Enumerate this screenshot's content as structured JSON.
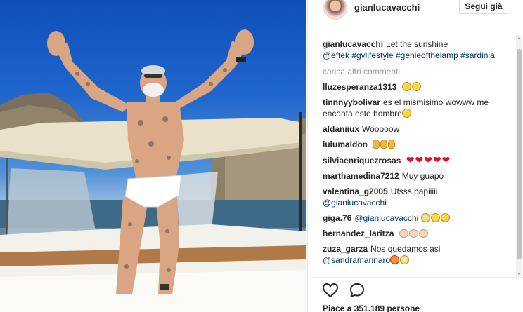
{
  "post": {
    "username": "gianlucavacchi",
    "follow_label": "Segui già",
    "caption_user": "gianlucavacchi",
    "caption_text": "Let the sunshine",
    "caption_tags": "@effek #gvlifestyle #genieofthelamp #sardinia",
    "load_more": "carica altri commenti",
    "likes": "Piace a 351.189 persone"
  },
  "comments": [
    {
      "user": "lluzesperanza1313",
      "text": "",
      "tag": "",
      "icons": [
        "smile-emoji",
        "smile-emoji"
      ]
    },
    {
      "user": "tinnnyybolivar",
      "text": "es el mismisimo wowww me encanta este hombre",
      "tag": "",
      "icons": [
        "smile-emoji"
      ]
    },
    {
      "user": "aldaniiux",
      "text": "Wooooow",
      "tag": "",
      "icons": []
    },
    {
      "user": "lulumaldon",
      "text": "",
      "tag": "",
      "icons": [
        "ok-hand-emoji",
        "ok-hand-emoji",
        "ok-hand-emoji"
      ]
    },
    {
      "user": "silviaenriquezrosas",
      "text": "",
      "tag": "",
      "icons": [
        "heart-emoji",
        "heart-emoji",
        "heart-emoji",
        "heart-emoji",
        "heart-emoji"
      ]
    },
    {
      "user": "marthamedina7212",
      "text": "Muy guapo",
      "tag": "",
      "icons": []
    },
    {
      "user": "valentina_g2005",
      "text": "Ufsss papiiiii",
      "tag": "@gianlucavacchi",
      "icons": []
    },
    {
      "user": "giga.76",
      "text": "",
      "tag": "@gianlucavacchi",
      "icons": [
        "scream-emoji",
        "smile-emoji",
        "kiss-emoji"
      ]
    },
    {
      "user": "hernandez_laritza",
      "text": "",
      "tag": "",
      "icons": [
        "clap-emoji",
        "clap-emoji",
        "clap-emoji"
      ]
    },
    {
      "user": "zuza_garza",
      "text": "Nos quedamos asi",
      "tag": "@sandramarinaro",
      "icons": [
        "angry-emoji",
        "scream-emoji"
      ]
    }
  ],
  "colors": {
    "link": "#003569",
    "heart": "#e0102e",
    "sky": "#1f66cc"
  }
}
